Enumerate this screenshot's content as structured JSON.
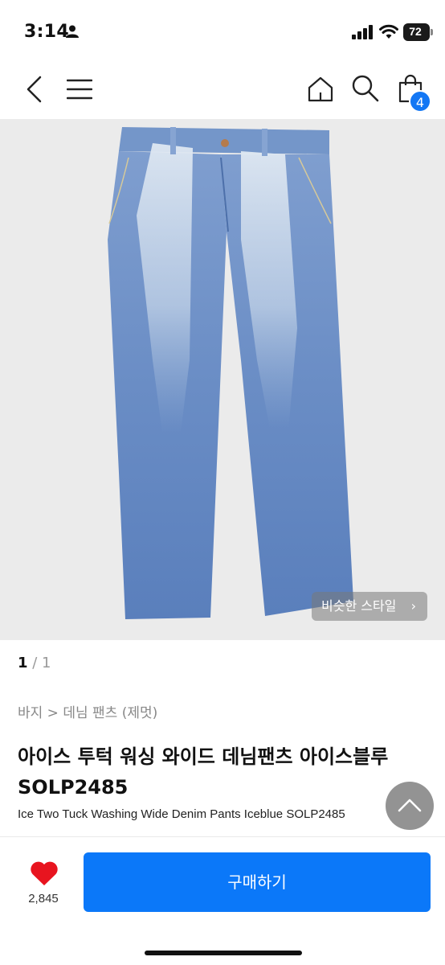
{
  "status": {
    "time": "3:14",
    "battery": "72"
  },
  "nav": {
    "cart_count": "4"
  },
  "image": {
    "similar_label": "비슷한 스타일",
    "chevron": "›"
  },
  "pager": {
    "current": "1",
    "separator": " / ",
    "total": "1"
  },
  "breadcrumb": "바지 > 데님 팬츠 (제멋)",
  "product": {
    "title_ko": "아이스 투턱 워싱 와이드 데님팬츠 아이스블루 SOLP2485",
    "title_en": "Ice Two Tuck Washing Wide Denim Pants Iceblue SOLP2485"
  },
  "bottom": {
    "like_count": "2,845",
    "buy_label": "구매하기"
  },
  "colors": {
    "accent": "#0b78f9",
    "badge": "#1377f4",
    "heart": "#e8141f",
    "denim": "#6b8fc4"
  }
}
